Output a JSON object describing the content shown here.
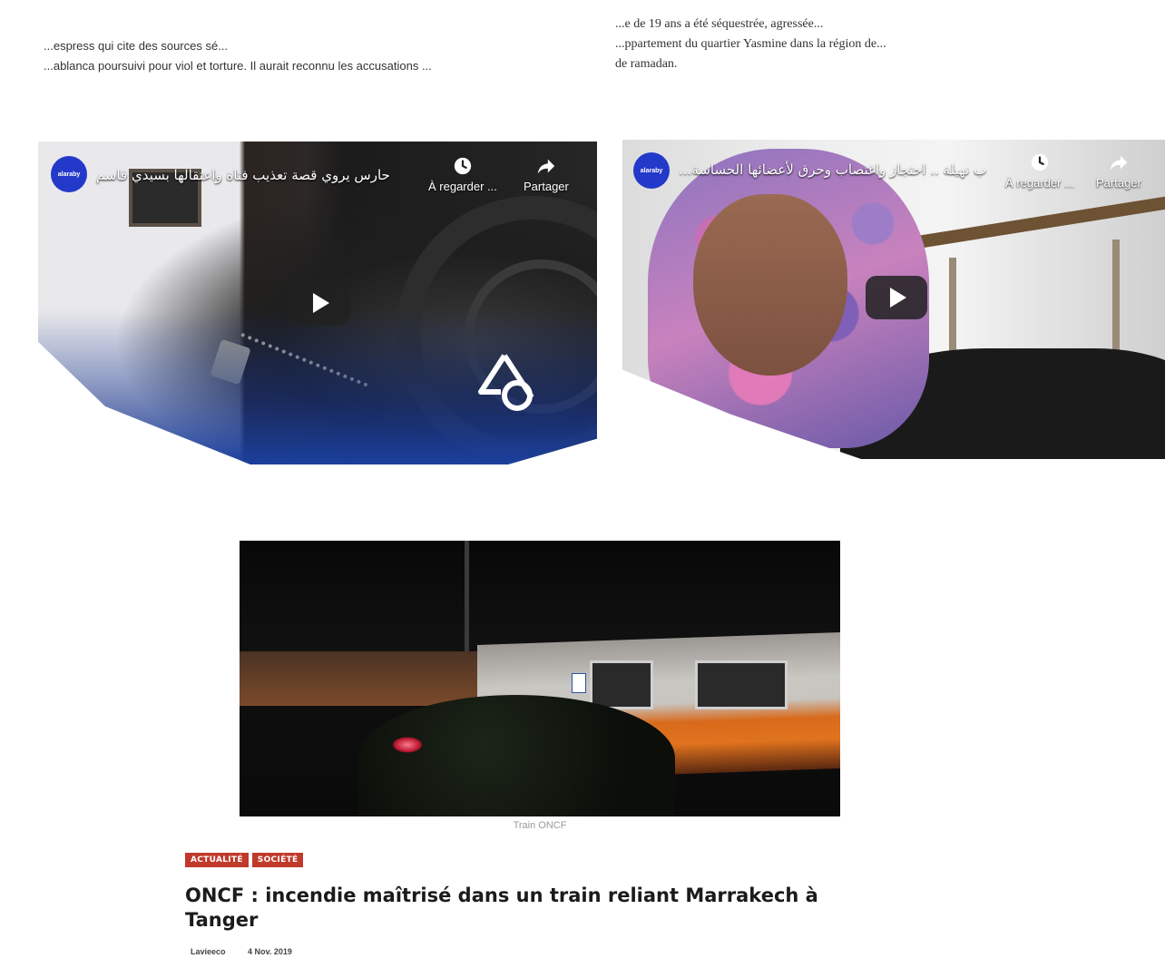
{
  "snippet_left": {
    "line1": "...espress qui cite des sources sé...",
    "line2": "...ablanca poursuivi pour viol et torture. Il aurait reconnu les accusations ..."
  },
  "snippet_right": {
    "line1": "...e de 19 ans a été séquestrée, agressée...",
    "line2": "...ppartement du quartier Yasmine dans la région de...",
    "line3": "de ramadan."
  },
  "video_left": {
    "channel_logo": "alaraby",
    "title": "حارس يروي قصة تعذيب فتاة واعتقالها بسيدي قاسم",
    "watch_later": "À regarder ...",
    "share": "Partager",
    "icons": [
      "clock-icon",
      "share-arrow-icon",
      "play-icon"
    ]
  },
  "video_right": {
    "channel_logo": "alaraby",
    "title": "...ب نهيلة .. احتجاز واغتصاب وحرق لأعضائها الحساسة",
    "watch_later": "À regarder ...",
    "share": "Partager",
    "icons": [
      "clock-icon",
      "share-arrow-icon",
      "play-icon"
    ]
  },
  "article": {
    "photo_caption": "Train ONCF",
    "categories": [
      "ACTUALITÉ",
      "SOCIÉTÉ"
    ],
    "title": "ONCF : incendie maîtrisé dans un train reliant Marrakech à Tanger",
    "author": "Lavieeco",
    "date": "4 Nov. 2019"
  },
  "colors": {
    "category_badge": "#c0392b",
    "video_logo": "#2339c9",
    "headline": "#1b1b1b"
  }
}
